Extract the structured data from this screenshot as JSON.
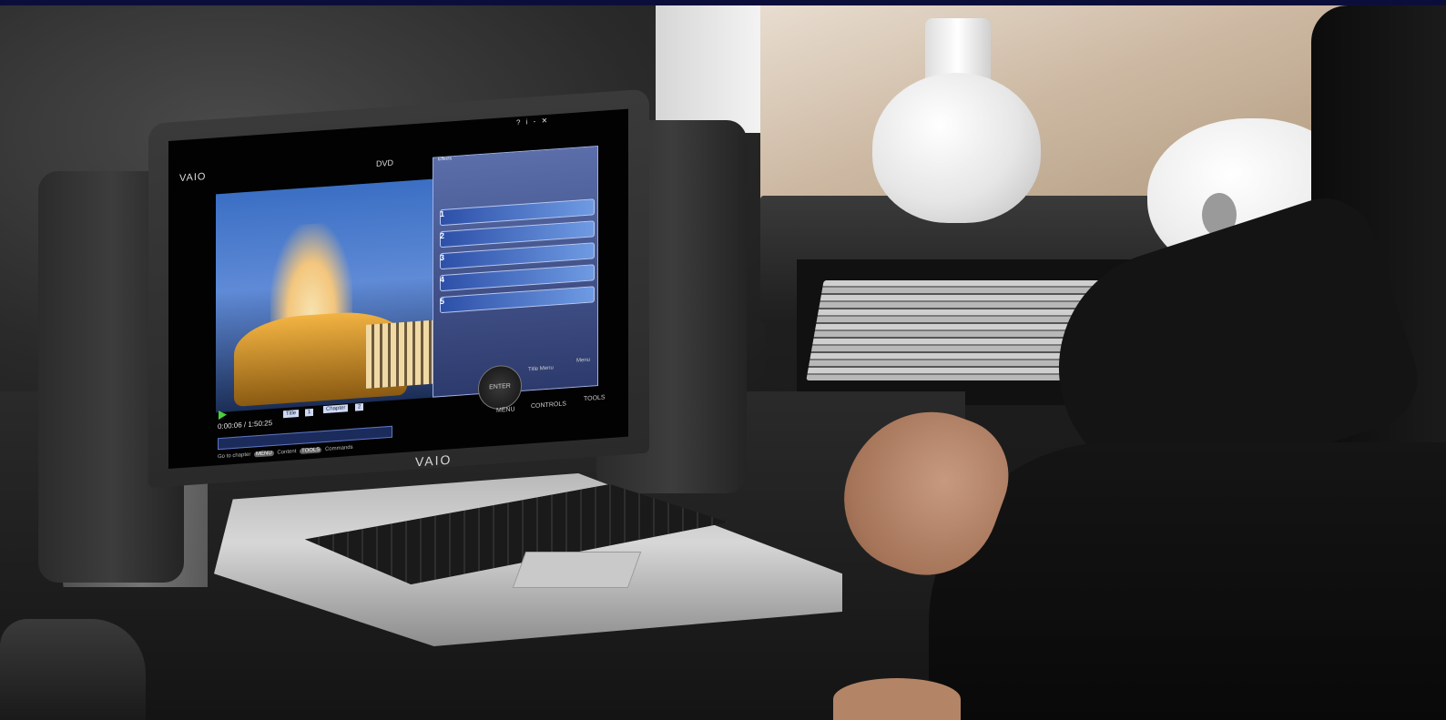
{
  "laptop": {
    "brand_lid": "VAIO",
    "brand_screen": "VAIO"
  },
  "player": {
    "source": "DVD",
    "timecode": "0:00:06 / 1:50:25",
    "title_label": "Title",
    "title_value": "1",
    "chapter_label": "Chapter",
    "chapter_value": "2",
    "enter_label": "ENTER",
    "title_menu_label": "Title Menu",
    "menu_label": "Menu",
    "controls": {
      "menu": "MENU",
      "controls": "CONTROLS",
      "tools": "TOOLS"
    },
    "hint": {
      "prefix": "Go to chapter",
      "menu_key": "MENU",
      "content": "Content",
      "tools_key": "TOOLS",
      "commands": "Commands"
    },
    "window_controls": "? i - ✕"
  },
  "effects_panel": {
    "title": "Effects",
    "rows": [
      {
        "num": "1"
      },
      {
        "num": "2"
      },
      {
        "num": "3"
      },
      {
        "num": "4"
      },
      {
        "num": "5"
      }
    ]
  }
}
